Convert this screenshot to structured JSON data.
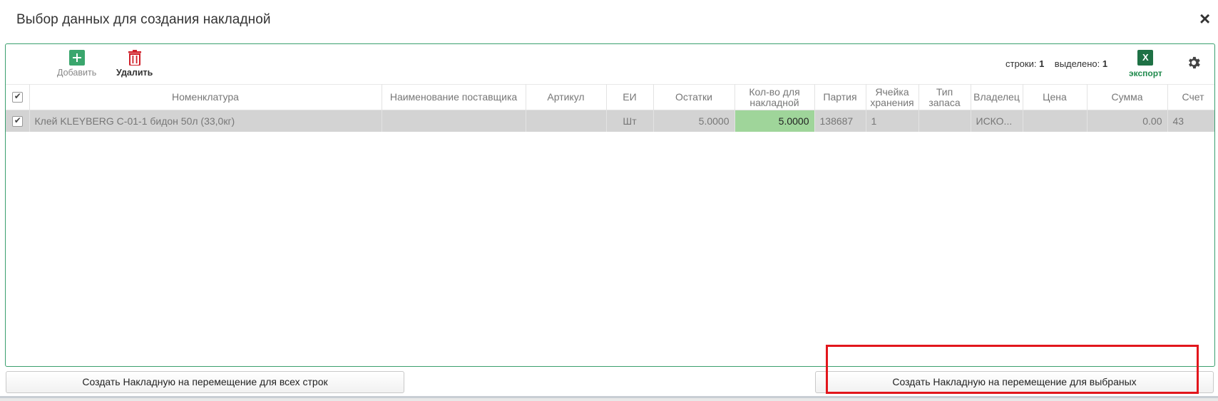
{
  "dialog": {
    "title": "Выбор данных для создания накладной",
    "close": "×"
  },
  "toolbar": {
    "add_label": "Добавить",
    "delete_label": "Удалить",
    "rows_label": "строки:",
    "rows_count": "1",
    "selected_label": "выделено:",
    "selected_count": "1",
    "export_label": "экспорт",
    "export_icon_text": "X"
  },
  "table": {
    "columns": [
      "Номенклатура",
      "Наименование поставщика",
      "Артикул",
      "ЕИ",
      "Остатки",
      "Кол-во для накладной",
      "Партия",
      "Ячейка хранения",
      "Тип запаса",
      "Владелец",
      "Цена",
      "Сумма",
      "Счет"
    ],
    "rows": [
      {
        "checked": true,
        "nomenclature": "Клей KLEYBERG С-01-1 бидон 50л (33,0кг)",
        "supplier_name": "",
        "article": "",
        "unit": "Шт",
        "stock": "5.0000",
        "qty": "5.0000",
        "batch": "138687",
        "cell": "1",
        "stock_type": "",
        "owner": "ИСКО...",
        "price": "",
        "sum": "0.00",
        "account": "43"
      }
    ]
  },
  "buttons": {
    "create_all": "Создать Накладную на перемещение для всех строк",
    "create_selected": "Создать Накладную на перемещение для выбраных"
  },
  "colors": {
    "accent": "#3a9f6e",
    "qty_highlight": "#9fd59a",
    "delete": "#d0202a",
    "annotation": "#e2161c"
  }
}
